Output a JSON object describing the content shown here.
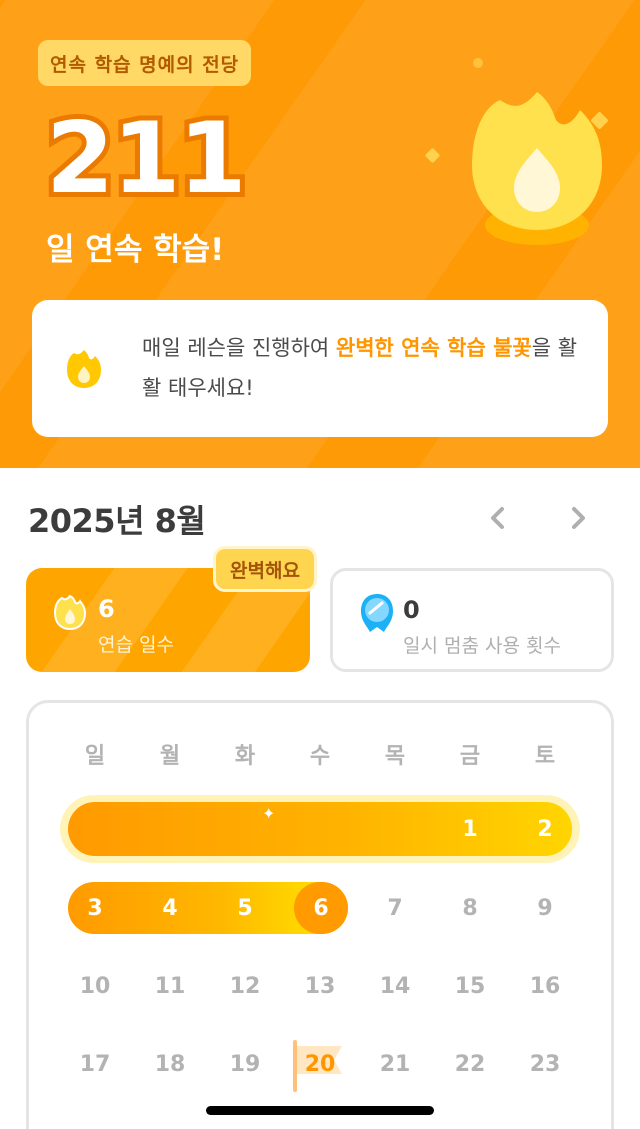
{
  "hero": {
    "badge": "연속 학습 명예의 전당",
    "streak_count": "211",
    "streak_label": "일 연속 학습!",
    "tip_prefix": "매일 레슨을 진행하여 ",
    "tip_highlight": "완벽한 연속 학습 불꽃",
    "tip_suffix": "을 활활 태우세요!",
    "icon": "flame-icon"
  },
  "calendar_header": {
    "month_title": "2025년 8월",
    "prev_icon": "chevron-left-icon",
    "next_icon": "chevron-right-icon"
  },
  "stats": {
    "perfect_badge": "완벽해요",
    "practice_value": "6",
    "practice_label": "연습 일수",
    "freeze_value": "0",
    "freeze_label": "일시 멈춤 사용 횟수"
  },
  "calendar": {
    "weekdays": [
      "일",
      "월",
      "화",
      "수",
      "목",
      "금",
      "토"
    ],
    "rows": [
      [
        "",
        "",
        "",
        "",
        "",
        "1",
        "2"
      ],
      [
        "3",
        "4",
        "5",
        "6",
        "7",
        "8",
        "9"
      ],
      [
        "10",
        "11",
        "12",
        "13",
        "14",
        "15",
        "16"
      ],
      [
        "17",
        "18",
        "19",
        "20",
        "21",
        "22",
        "23"
      ]
    ],
    "completed_days": [
      "1",
      "2",
      "3",
      "4",
      "5",
      "6"
    ],
    "today": "6",
    "goal_day": "20",
    "sparkle": "✦"
  },
  "colors": {
    "hero_bg": "#ff9a07",
    "accent": "#ff9600",
    "badge": "#ffd866"
  }
}
